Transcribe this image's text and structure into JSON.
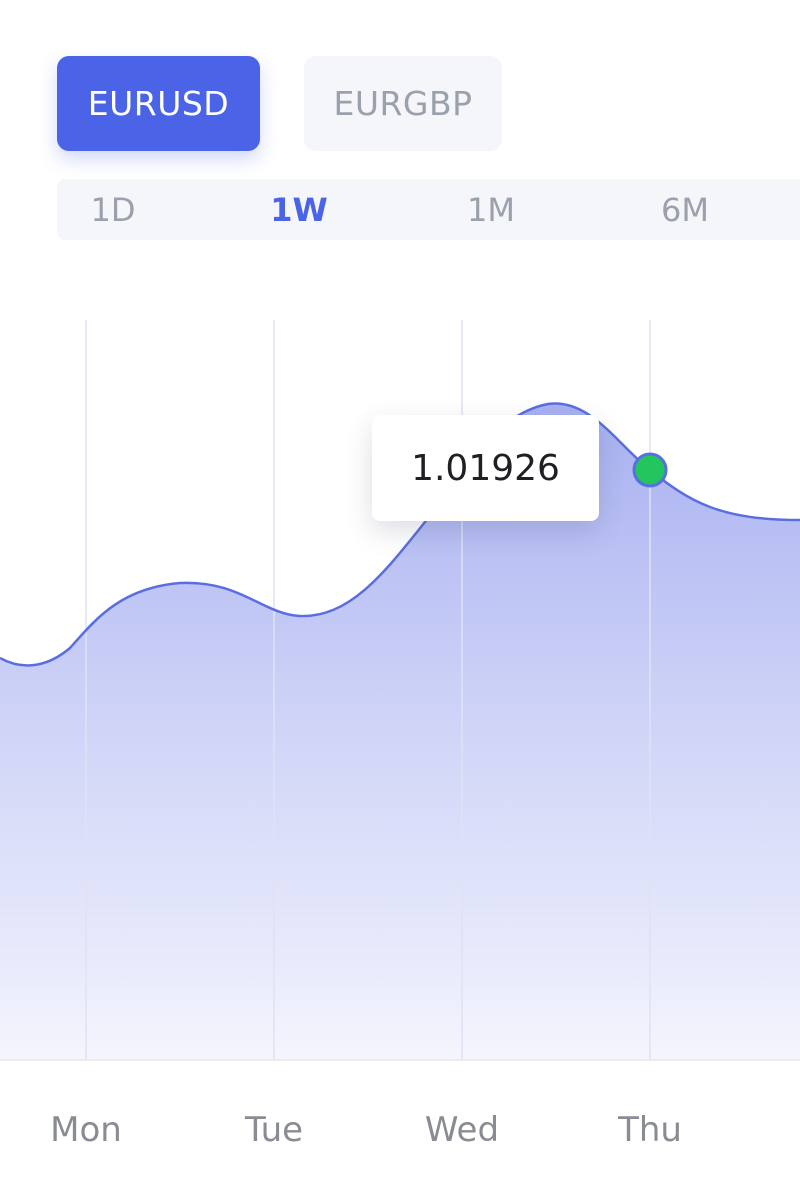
{
  "pairs": [
    {
      "label": "EURUSD",
      "active": true
    },
    {
      "label": "EURGBP",
      "active": false
    }
  ],
  "ranges": [
    {
      "label": "1D",
      "active": false
    },
    {
      "label": "1W",
      "active": true
    },
    {
      "label": "1M",
      "active": false
    },
    {
      "label": "6M",
      "active": false
    }
  ],
  "tooltip": {
    "value": "1.01926"
  },
  "colors": {
    "accent": "#4b63e6",
    "marker": "#22c55e",
    "area_top": "#a3acf0",
    "area_bottom": "#f4f5fd"
  },
  "chart_data": {
    "type": "area",
    "title": "",
    "xlabel": "",
    "ylabel": "",
    "categories": [
      "Mon",
      "Tue",
      "Wed",
      "Thu"
    ],
    "grid": "vertical",
    "highlight": {
      "category": "Thu",
      "value": 1.01926,
      "marker": "green-dot"
    }
  }
}
